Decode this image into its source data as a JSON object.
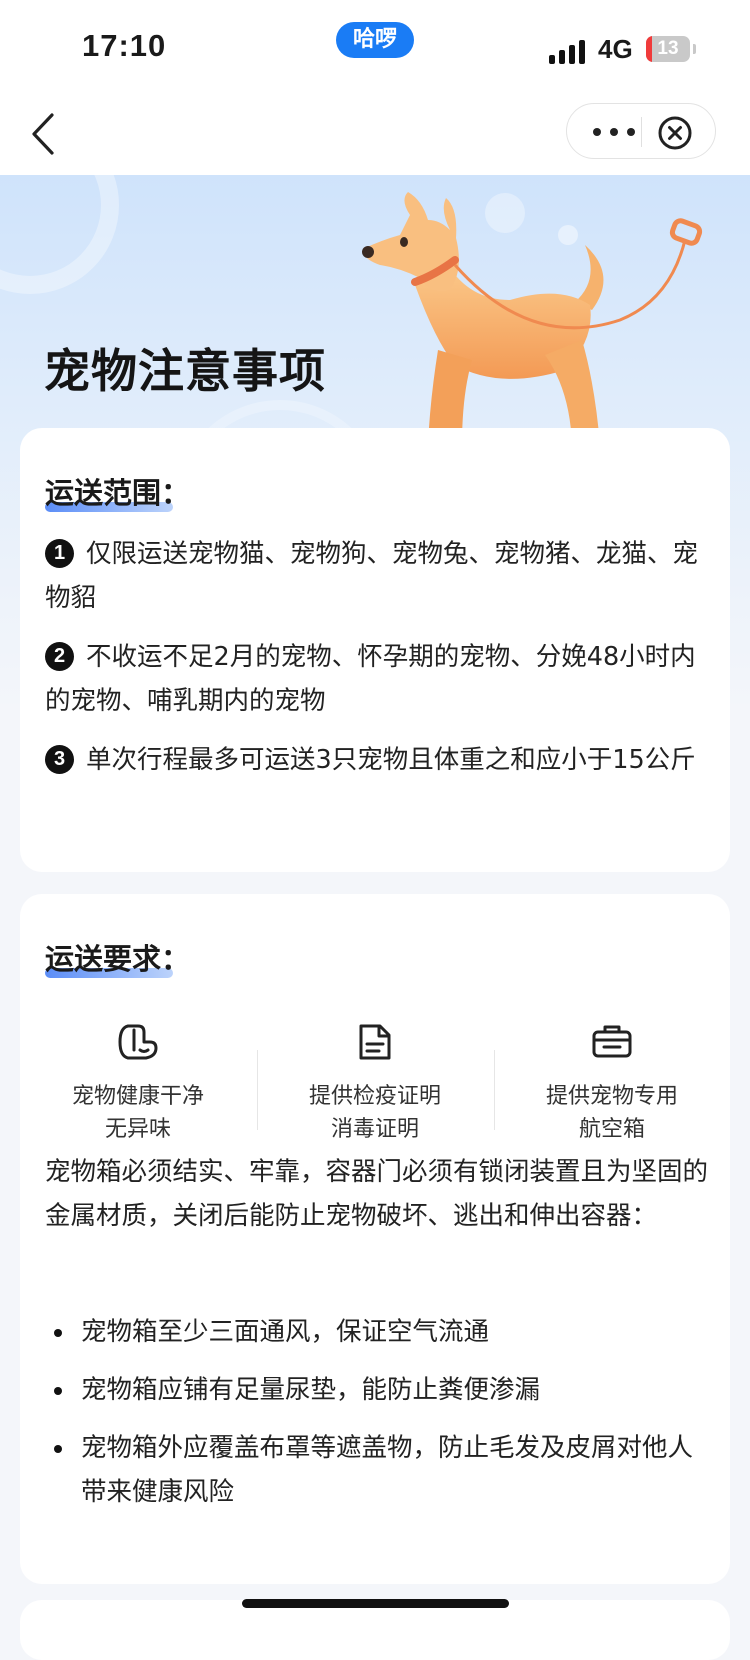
{
  "status": {
    "time": "17:10",
    "pill": "哈啰",
    "network": "4G",
    "battery": "13",
    "battery_level": 0.13
  },
  "nav": {
    "back": "back",
    "more": "more",
    "close": "close"
  },
  "hero": {
    "title": "宠物注意事项"
  },
  "scope": {
    "title": "运送范围：",
    "items": [
      {
        "num": "1",
        "text": "仅限运送宠物猫、宠物狗、宠物兔、宠物猪、龙猫、宠物貂"
      },
      {
        "num": "2",
        "text": "不收运不足2月的宠物、怀孕期的宠物、分娩48小时内的宠物、哺乳期内的宠物"
      },
      {
        "num": "3",
        "text": "单次行程最多可运送3只宠物且体重之和应小于15公斤"
      }
    ]
  },
  "requirements": {
    "title": "运送要求：",
    "cards": [
      {
        "icon": "pet-health-icon",
        "line1": "宠物健康干净",
        "line2": "无异味"
      },
      {
        "icon": "document-icon",
        "line1": "提供检疫证明",
        "line2": "消毒证明"
      },
      {
        "icon": "pet-carrier-icon",
        "line1": "提供宠物专用",
        "line2": "航空箱"
      }
    ],
    "intro": "宠物箱必须结实、牢靠，容器门必须有锁闭装置且为坚固的金属材质，关闭后能防止宠物破坏、逃出和伸出容器：",
    "bullets": [
      "宠物箱至少三面通风，保证空气流通",
      "宠物箱应铺有足量尿垫，能防止粪便渗漏",
      "宠物箱外应覆盖布罩等遮盖物，防止毛发及皮屑对他人带来健康风险"
    ]
  },
  "colors": {
    "accent": "#1a7cf5",
    "underline": "#5b8df7",
    "dog": "#f6a55f"
  }
}
